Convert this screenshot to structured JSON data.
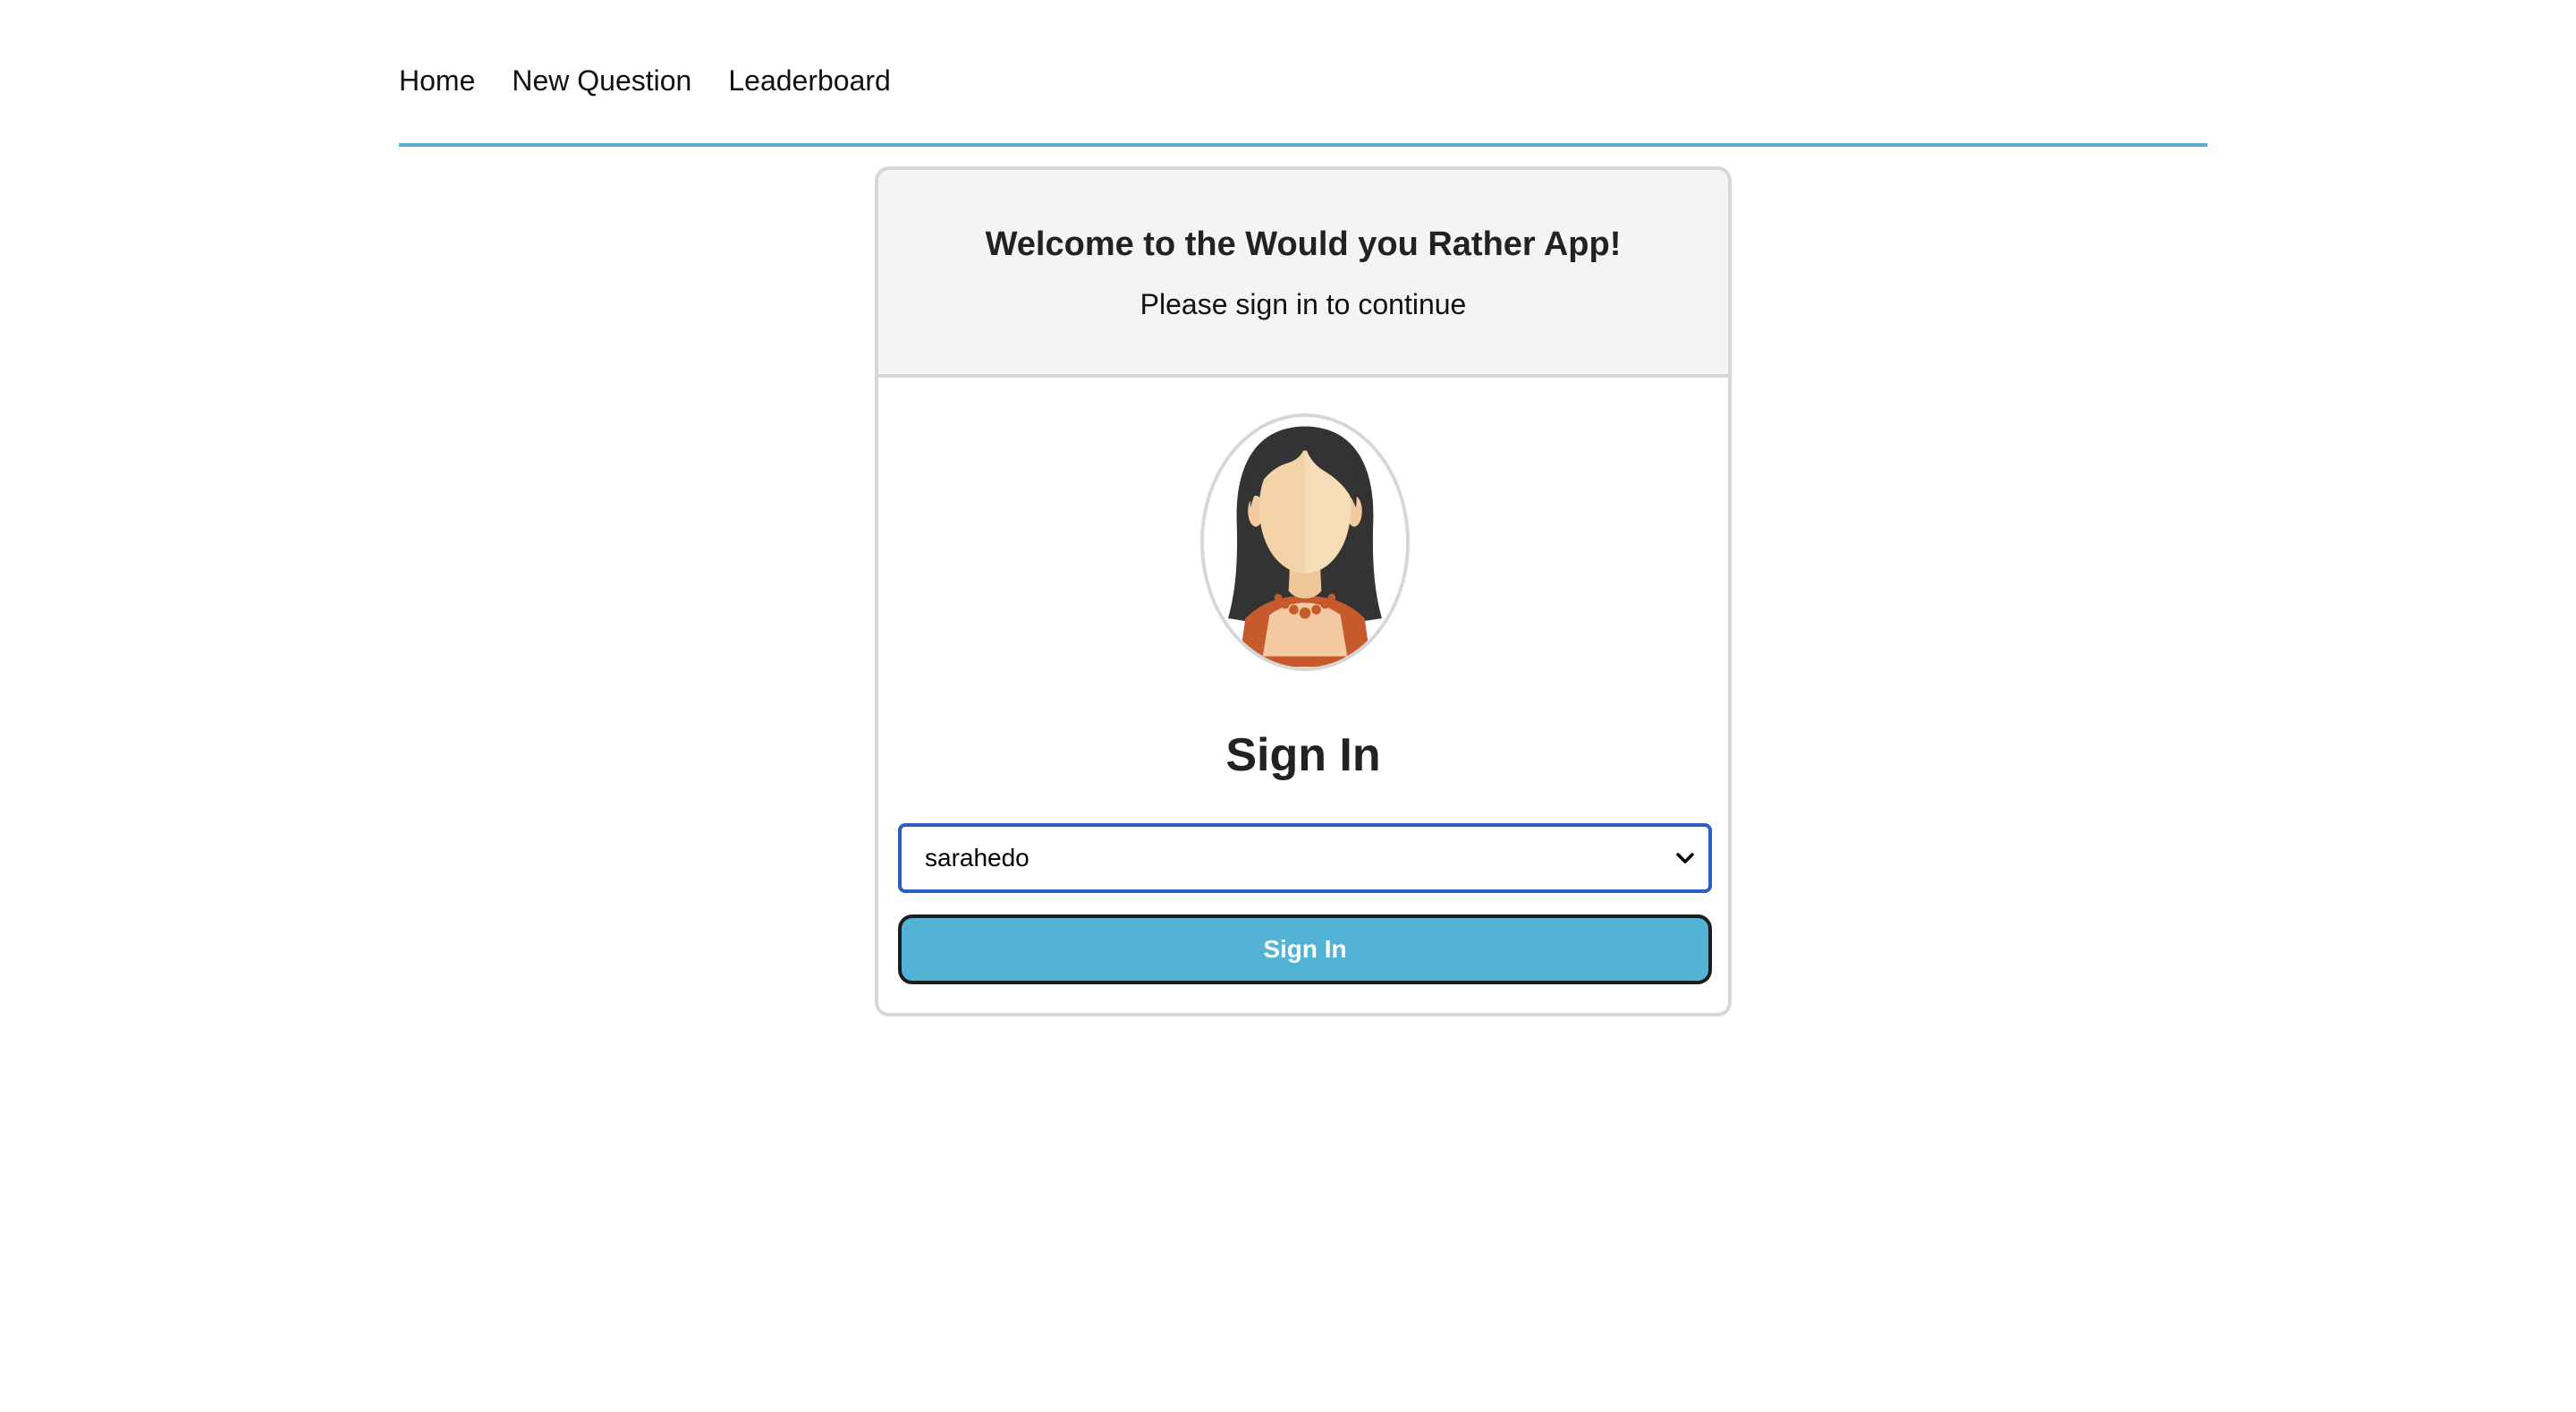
{
  "nav": {
    "items": [
      {
        "label": "Home"
      },
      {
        "label": "New Question"
      },
      {
        "label": "Leaderboard"
      }
    ]
  },
  "card": {
    "title": "Welcome to the Would you Rather App!",
    "subtitle": "Please sign in to continue",
    "avatar_icon": "female-avatar-icon",
    "signin_title": "Sign In",
    "user_select": {
      "selected": "sarahedo"
    },
    "signin_button_label": "Sign In"
  },
  "colors": {
    "nav_underline": "#5aafd0",
    "button_bg": "#52b3d4",
    "select_focus_border": "#2a5fc0",
    "header_bg": "#f3f4f5"
  }
}
